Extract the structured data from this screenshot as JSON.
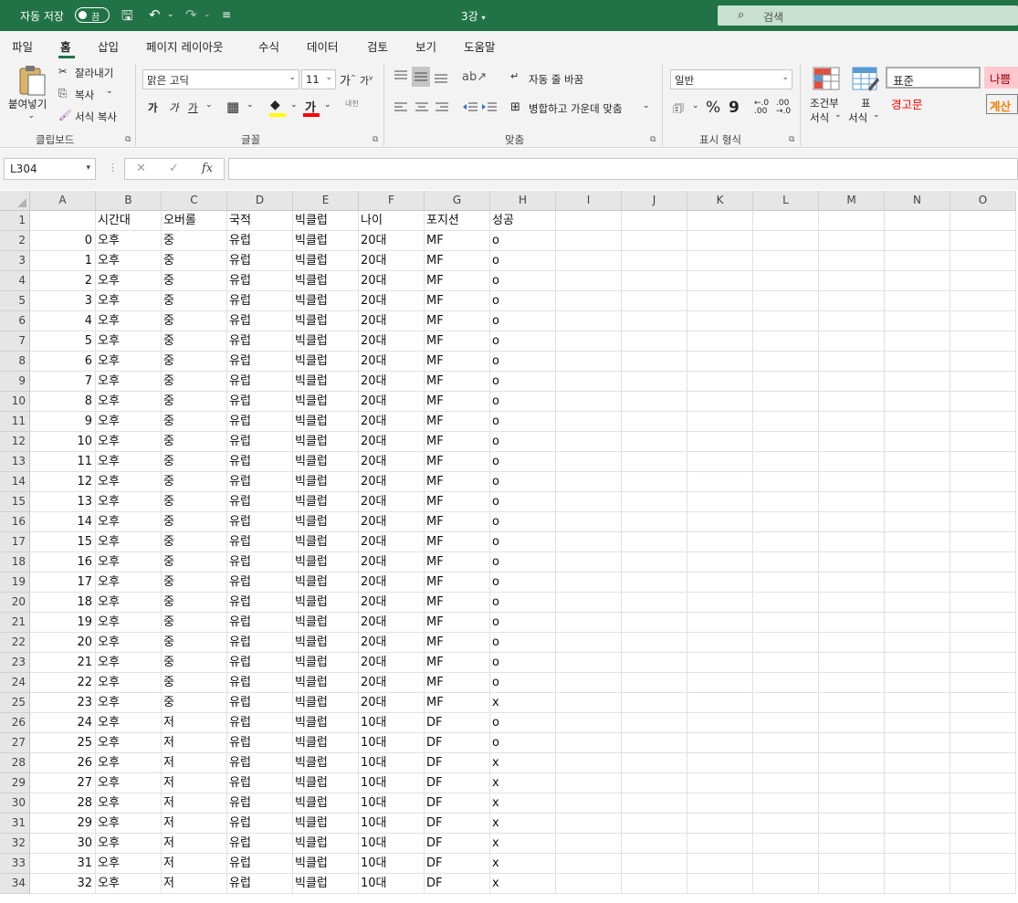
{
  "titlebar": {
    "autosave_label": "자동 저장",
    "autosave_state": "끔",
    "doc_title": "3강",
    "search_placeholder": "검색"
  },
  "menu_tabs": [
    "파일",
    "홈",
    "삽입",
    "페이지 레이아웃",
    "수식",
    "데이터",
    "검토",
    "보기",
    "도움말"
  ],
  "active_tab": "홈",
  "ribbon": {
    "clipboard": {
      "paste": "붙여넣기",
      "cut": "잘라내기",
      "copy": "복사",
      "format_painter": "서식 복사",
      "group": "클립보드"
    },
    "font": {
      "font_name": "맑은 고딕",
      "font_size": "11",
      "grow": "가",
      "shrink": "가",
      "bold": "가",
      "italic": "가",
      "underline": "가",
      "font_color_glyph": "가",
      "phonetic": "내천",
      "group": "글꼴"
    },
    "alignment": {
      "wrap_text": "자동 줄 바꿈",
      "merge_center": "병합하고 가운데 맞춤",
      "group": "맞춤"
    },
    "number": {
      "format": "일반",
      "percent": "%",
      "comma": "9",
      "group": "표시 형식"
    },
    "styles": {
      "conditional": "조건부",
      "conditional_sub": "서식",
      "table": "표",
      "table_sub": "서식",
      "normal": "표준",
      "bad": "나쁨",
      "warning": "경고문",
      "calc": "계산"
    }
  },
  "formula_bar": {
    "name_box": "L304",
    "cancel": "✕",
    "enter": "✓",
    "fx": "fx",
    "content": ""
  },
  "grid": {
    "columns": [
      "A",
      "B",
      "C",
      "D",
      "E",
      "F",
      "G",
      "H",
      "I",
      "J",
      "K",
      "L",
      "M",
      "N",
      "O"
    ],
    "row_numbers": [
      1,
      2,
      3,
      4,
      5,
      6,
      7,
      8,
      9,
      10,
      11,
      12,
      13,
      14,
      15,
      16,
      17,
      18,
      19,
      20,
      21,
      22,
      23,
      24,
      25,
      26,
      27,
      28,
      29,
      30,
      31,
      32,
      33,
      34
    ],
    "header_row": [
      "",
      "시간대",
      "오버롤",
      "국적",
      "빅클럽",
      "나이",
      "포지션",
      "성공"
    ],
    "rows": [
      [
        "0",
        "오후",
        "중",
        "유럽",
        "빅클럽",
        "20대",
        "MF",
        "o"
      ],
      [
        "1",
        "오후",
        "중",
        "유럽",
        "빅클럽",
        "20대",
        "MF",
        "o"
      ],
      [
        "2",
        "오후",
        "중",
        "유럽",
        "빅클럽",
        "20대",
        "MF",
        "o"
      ],
      [
        "3",
        "오후",
        "중",
        "유럽",
        "빅클럽",
        "20대",
        "MF",
        "o"
      ],
      [
        "4",
        "오후",
        "중",
        "유럽",
        "빅클럽",
        "20대",
        "MF",
        "o"
      ],
      [
        "5",
        "오후",
        "중",
        "유럽",
        "빅클럽",
        "20대",
        "MF",
        "o"
      ],
      [
        "6",
        "오후",
        "중",
        "유럽",
        "빅클럽",
        "20대",
        "MF",
        "o"
      ],
      [
        "7",
        "오후",
        "중",
        "유럽",
        "빅클럽",
        "20대",
        "MF",
        "o"
      ],
      [
        "8",
        "오후",
        "중",
        "유럽",
        "빅클럽",
        "20대",
        "MF",
        "o"
      ],
      [
        "9",
        "오후",
        "중",
        "유럽",
        "빅클럽",
        "20대",
        "MF",
        "o"
      ],
      [
        "10",
        "오후",
        "중",
        "유럽",
        "빅클럽",
        "20대",
        "MF",
        "o"
      ],
      [
        "11",
        "오후",
        "중",
        "유럽",
        "빅클럽",
        "20대",
        "MF",
        "o"
      ],
      [
        "12",
        "오후",
        "중",
        "유럽",
        "빅클럽",
        "20대",
        "MF",
        "o"
      ],
      [
        "13",
        "오후",
        "중",
        "유럽",
        "빅클럽",
        "20대",
        "MF",
        "o"
      ],
      [
        "14",
        "오후",
        "중",
        "유럽",
        "빅클럽",
        "20대",
        "MF",
        "o"
      ],
      [
        "15",
        "오후",
        "중",
        "유럽",
        "빅클럽",
        "20대",
        "MF",
        "o"
      ],
      [
        "16",
        "오후",
        "중",
        "유럽",
        "빅클럽",
        "20대",
        "MF",
        "o"
      ],
      [
        "17",
        "오후",
        "중",
        "유럽",
        "빅클럽",
        "20대",
        "MF",
        "o"
      ],
      [
        "18",
        "오후",
        "중",
        "유럽",
        "빅클럽",
        "20대",
        "MF",
        "o"
      ],
      [
        "19",
        "오후",
        "중",
        "유럽",
        "빅클럽",
        "20대",
        "MF",
        "o"
      ],
      [
        "20",
        "오후",
        "중",
        "유럽",
        "빅클럽",
        "20대",
        "MF",
        "o"
      ],
      [
        "21",
        "오후",
        "중",
        "유럽",
        "빅클럽",
        "20대",
        "MF",
        "o"
      ],
      [
        "22",
        "오후",
        "중",
        "유럽",
        "빅클럽",
        "20대",
        "MF",
        "o"
      ],
      [
        "23",
        "오후",
        "중",
        "유럽",
        "빅클럽",
        "20대",
        "MF",
        "x"
      ],
      [
        "24",
        "오후",
        "저",
        "유럽",
        "빅클럽",
        "10대",
        "DF",
        "o"
      ],
      [
        "25",
        "오후",
        "저",
        "유럽",
        "빅클럽",
        "10대",
        "DF",
        "o"
      ],
      [
        "26",
        "오후",
        "저",
        "유럽",
        "빅클럽",
        "10대",
        "DF",
        "x"
      ],
      [
        "27",
        "오후",
        "저",
        "유럽",
        "빅클럽",
        "10대",
        "DF",
        "x"
      ],
      [
        "28",
        "오후",
        "저",
        "유럽",
        "빅클럽",
        "10대",
        "DF",
        "x"
      ],
      [
        "29",
        "오후",
        "저",
        "유럽",
        "빅클럽",
        "10대",
        "DF",
        "x"
      ],
      [
        "30",
        "오후",
        "저",
        "유럽",
        "빅클럽",
        "10대",
        "DF",
        "x"
      ],
      [
        "31",
        "오후",
        "저",
        "유럽",
        "빅클럽",
        "10대",
        "DF",
        "x"
      ],
      [
        "32",
        "오후",
        "저",
        "유럽",
        "빅클럽",
        "10대",
        "DF",
        "x"
      ]
    ]
  },
  "colors": {
    "brand": "#217346",
    "bad_bg": "#ffc7ce",
    "bad_text": "#9c0006",
    "warning_text": "#ff0000",
    "calc_text": "#fa7d00"
  }
}
